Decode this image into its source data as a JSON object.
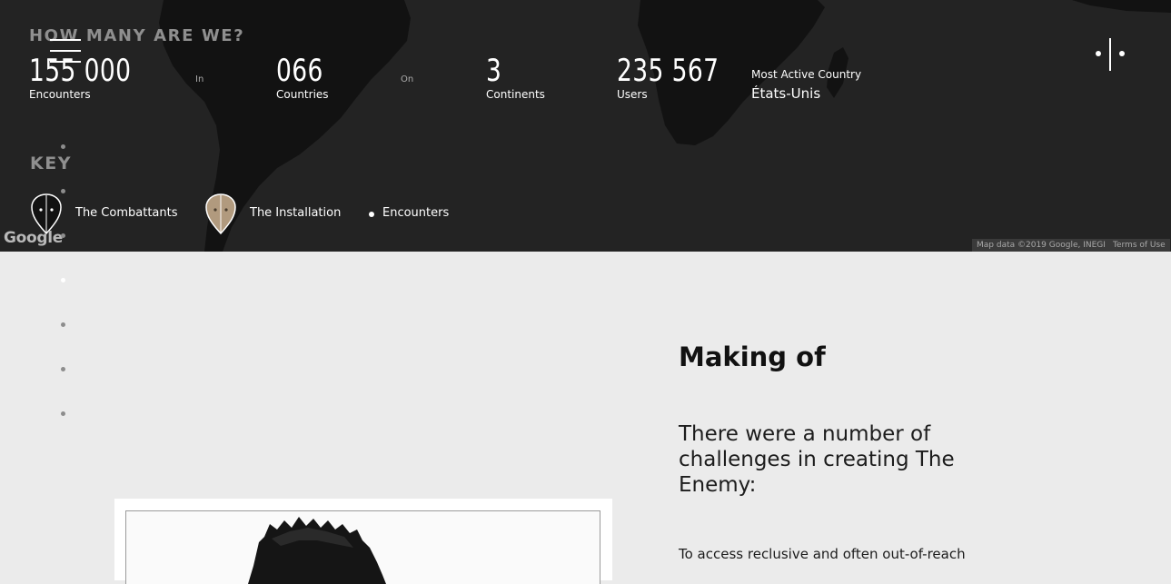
{
  "header": {
    "section_title": "HOW MANY ARE WE?",
    "stats": [
      {
        "number": "155 000",
        "label": "Encounters"
      },
      {
        "number": "066",
        "label": "Countries"
      },
      {
        "number": "3",
        "label": "Continents"
      },
      {
        "number": "235 567",
        "label": "Users"
      }
    ],
    "separators": [
      "In",
      "On"
    ],
    "most_active_label": "Most Active Country",
    "most_active_value": "États-Unis"
  },
  "key": {
    "title": "KEY",
    "items": [
      {
        "label": "The Combattants",
        "icon": "combatant-pin-icon"
      },
      {
        "label": "The Installation",
        "icon": "installation-pin-icon"
      },
      {
        "label": "Encounters",
        "icon": "encounter-dot-icon"
      }
    ]
  },
  "map": {
    "logo": "Google",
    "attribution": "Map data ©2019 Google, INEGI",
    "terms": "Terms of Use"
  },
  "making_of": {
    "title": "Making of",
    "intro": "There were a number of challenges in creating The Enemy:",
    "paragraph": "To access reclusive and often out-of-reach"
  },
  "colors": {
    "map_bg": "#232323",
    "land": "#121212",
    "page_bg": "#ebebeb",
    "installation_pin": "#b19a7e"
  }
}
